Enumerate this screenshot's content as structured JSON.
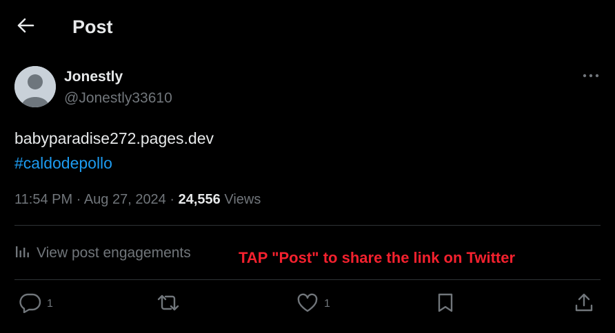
{
  "header": {
    "title": "Post"
  },
  "author": {
    "name": "Jonestly",
    "handle": "@Jonestly33610"
  },
  "post": {
    "link": "babyparadise272.pages.dev",
    "hashtag": "#caldodepollo"
  },
  "meta": {
    "time": "11:54 PM",
    "date": "Aug 27, 2024",
    "separator": "·",
    "views": "24,556",
    "views_label": "Views"
  },
  "engagements_label": "View post engagements",
  "overlay_note": "TAP \"Post\" to share the link on Twitter",
  "actions": {
    "replies": "1",
    "likes": "1"
  },
  "colors": {
    "background": "#000000",
    "text": "#e7e9ea",
    "muted": "#71767b",
    "link": "#1d9bf0",
    "overlay": "#f4212e"
  }
}
